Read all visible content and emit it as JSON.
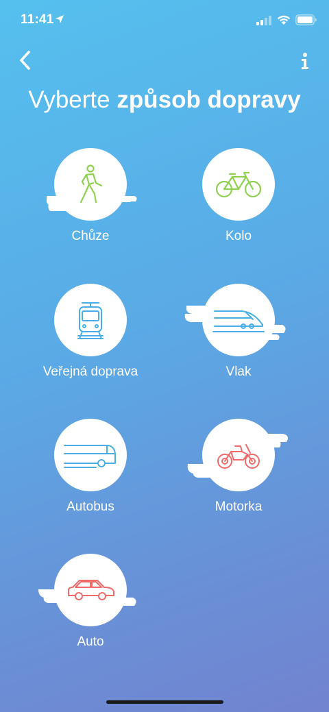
{
  "status_bar": {
    "time": "11:41"
  },
  "header": {
    "title_light": "Vyberte",
    "title_bold": "způsob dopravy"
  },
  "modes": [
    {
      "label": "Chůze",
      "icon": "walking-person-icon",
      "color": "#8fd14f"
    },
    {
      "label": "Kolo",
      "icon": "bicycle-icon",
      "color": "#8fd14f"
    },
    {
      "label": "Veřejná doprava",
      "icon": "tram-icon",
      "color": "#4aaee6"
    },
    {
      "label": "Vlak",
      "icon": "train-icon",
      "color": "#4aaee6"
    },
    {
      "label": "Autobus",
      "icon": "bus-icon",
      "color": "#4aaee6"
    },
    {
      "label": "Motorka",
      "icon": "motorcycle-icon",
      "color": "#f06a6a"
    },
    {
      "label": "Auto",
      "icon": "car-icon",
      "color": "#f06a6a"
    }
  ]
}
